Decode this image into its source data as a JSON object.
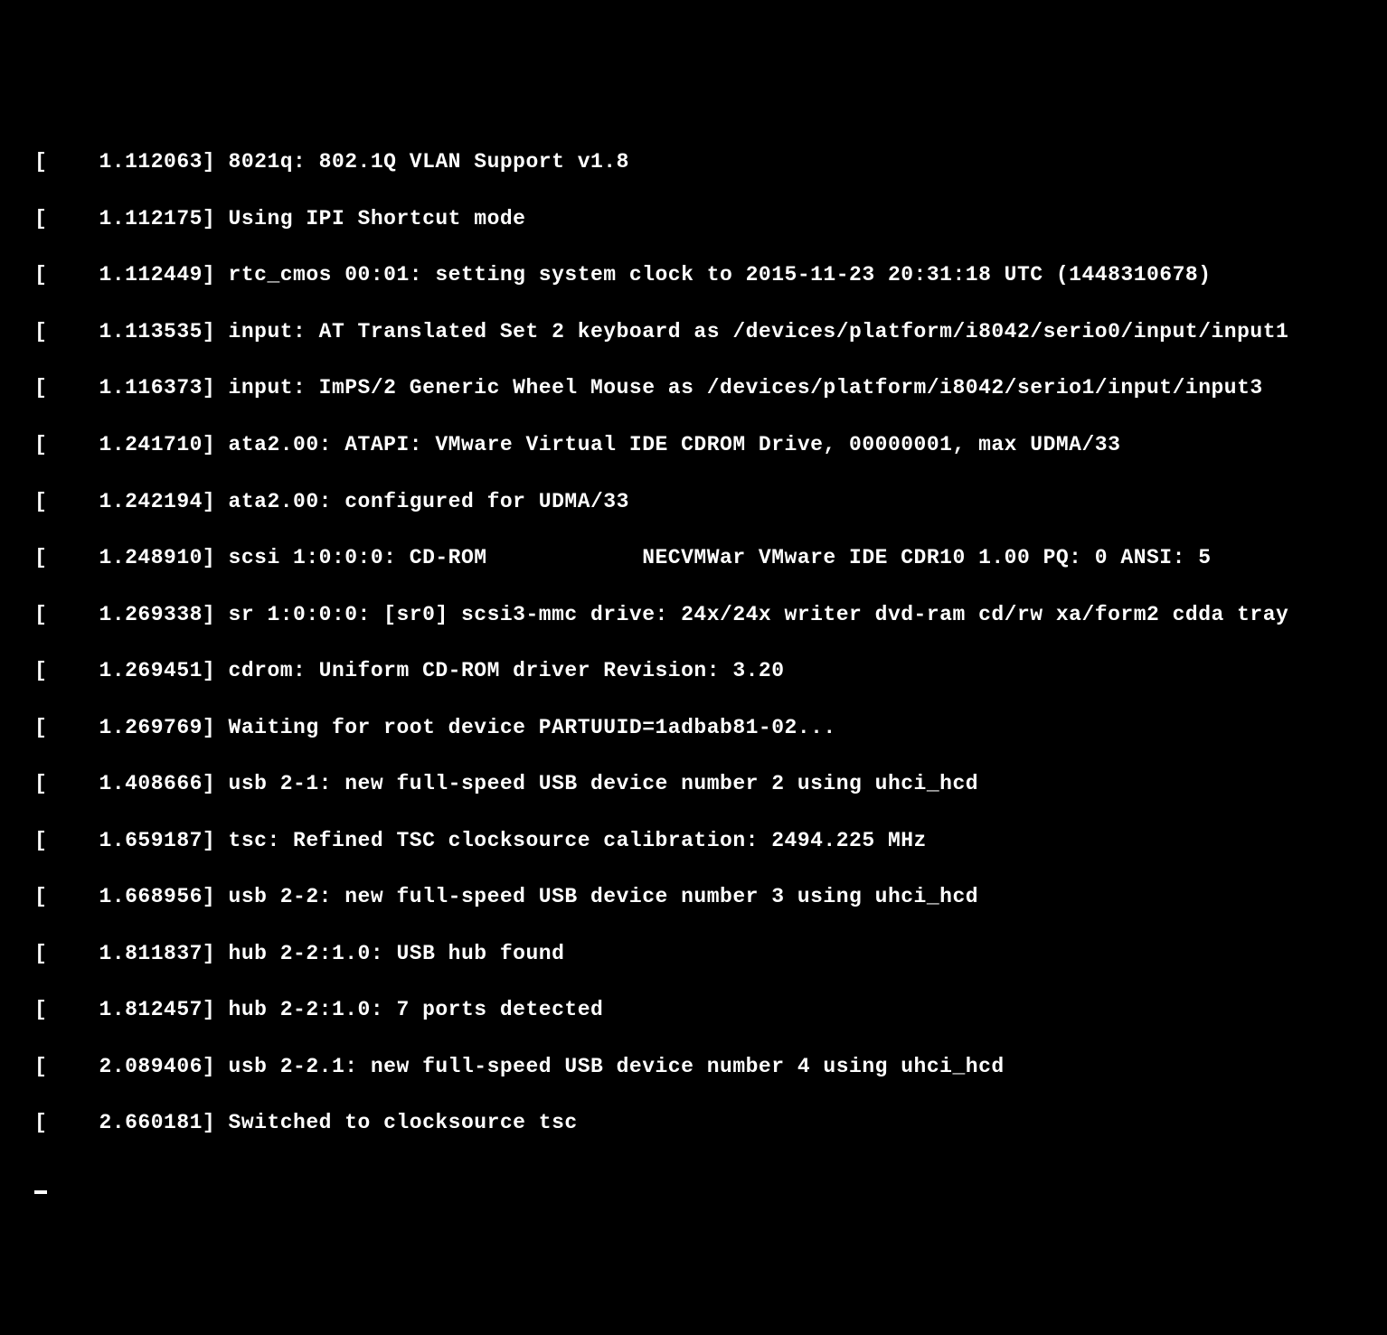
{
  "boot_log": {
    "lines": [
      "[    1.112063] 8021q: 802.1Q VLAN Support v1.8",
      "[    1.112175] Using IPI Shortcut mode",
      "[    1.112449] rtc_cmos 00:01: setting system clock to 2015-11-23 20:31:18 UTC (1448310678)",
      "[    1.113535] input: AT Translated Set 2 keyboard as /devices/platform/i8042/serio0/input/input1",
      "[    1.116373] input: ImPS/2 Generic Wheel Mouse as /devices/platform/i8042/serio1/input/input3",
      "[    1.241710] ata2.00: ATAPI: VMware Virtual IDE CDROM Drive, 00000001, max UDMA/33",
      "[    1.242194] ata2.00: configured for UDMA/33",
      "[    1.248910] scsi 1:0:0:0: CD-ROM            NECVMWar VMware IDE CDR10 1.00 PQ: 0 ANSI: 5",
      "[    1.269338] sr 1:0:0:0: [sr0] scsi3-mmc drive: 24x/24x writer dvd-ram cd/rw xa/form2 cdda tray",
      "[    1.269451] cdrom: Uniform CD-ROM driver Revision: 3.20",
      "[    1.269769] Waiting for root device PARTUUID=1adbab81-02...",
      "[    1.408666] usb 2-1: new full-speed USB device number 2 using uhci_hcd",
      "[    1.659187] tsc: Refined TSC clocksource calibration: 2494.225 MHz",
      "[    1.668956] usb 2-2: new full-speed USB device number 3 using uhci_hcd",
      "[    1.811837] hub 2-2:1.0: USB hub found",
      "[    1.812457] hub 2-2:1.0: 7 ports detected",
      "[    2.089406] usb 2-2.1: new full-speed USB device number 4 using uhci_hcd",
      "[    2.660181] Switched to clocksource tsc"
    ]
  }
}
